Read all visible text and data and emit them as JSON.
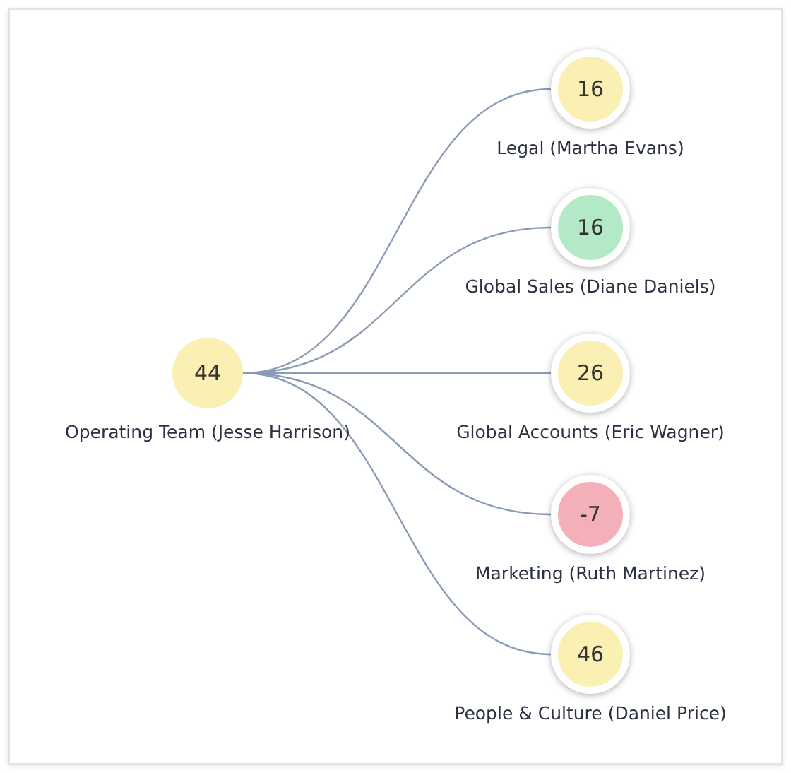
{
  "root": {
    "value": "44",
    "label": "Operating Team (Jesse Harrison)",
    "color": "#fbf0b4"
  },
  "children": [
    {
      "value": "16",
      "label": "Legal (Martha Evans)",
      "color": "#fbf0b4"
    },
    {
      "value": "16",
      "label": "Global Sales (Diane Daniels)",
      "color": "#b3e9c7"
    },
    {
      "value": "26",
      "label": "Global Accounts (Eric Wagner)",
      "color": "#fbf0b4"
    },
    {
      "value": "-7",
      "label": "Marketing (Ruth Martinez)",
      "color": "#f3b0b8"
    },
    {
      "value": "46",
      "label": "People & Culture (Daniel Price)",
      "color": "#fbf0b4"
    }
  ]
}
